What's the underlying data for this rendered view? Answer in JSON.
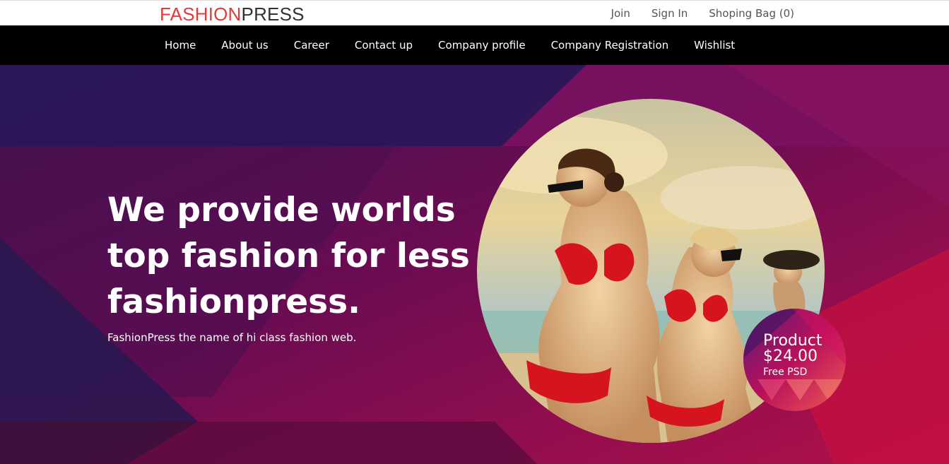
{
  "logo": {
    "part1": "FASHION",
    "part2": "PRESS"
  },
  "top_links": {
    "join": "Join",
    "sign_in": "Sign In",
    "bag": "Shoping Bag (0)"
  },
  "nav": {
    "home": "Home",
    "about": "About us",
    "career": "Career",
    "contact": "Contact up",
    "profile": "Company profile",
    "registration": "Company Registration",
    "wishlist": "Wishlist"
  },
  "hero": {
    "line1": "We provide worlds",
    "line2": "top fashion for less",
    "line3": "fashionpress.",
    "subtitle": "FashionPress the name of hi class fashion web."
  },
  "badge": {
    "label": "Product",
    "price": "$24.00",
    "note": "Free PSD"
  },
  "colors": {
    "logo_red": "#e53a3a",
    "nav_bg": "#000000",
    "hero_purple": "#5a0c4e",
    "hero_magenta": "#a0104e"
  }
}
